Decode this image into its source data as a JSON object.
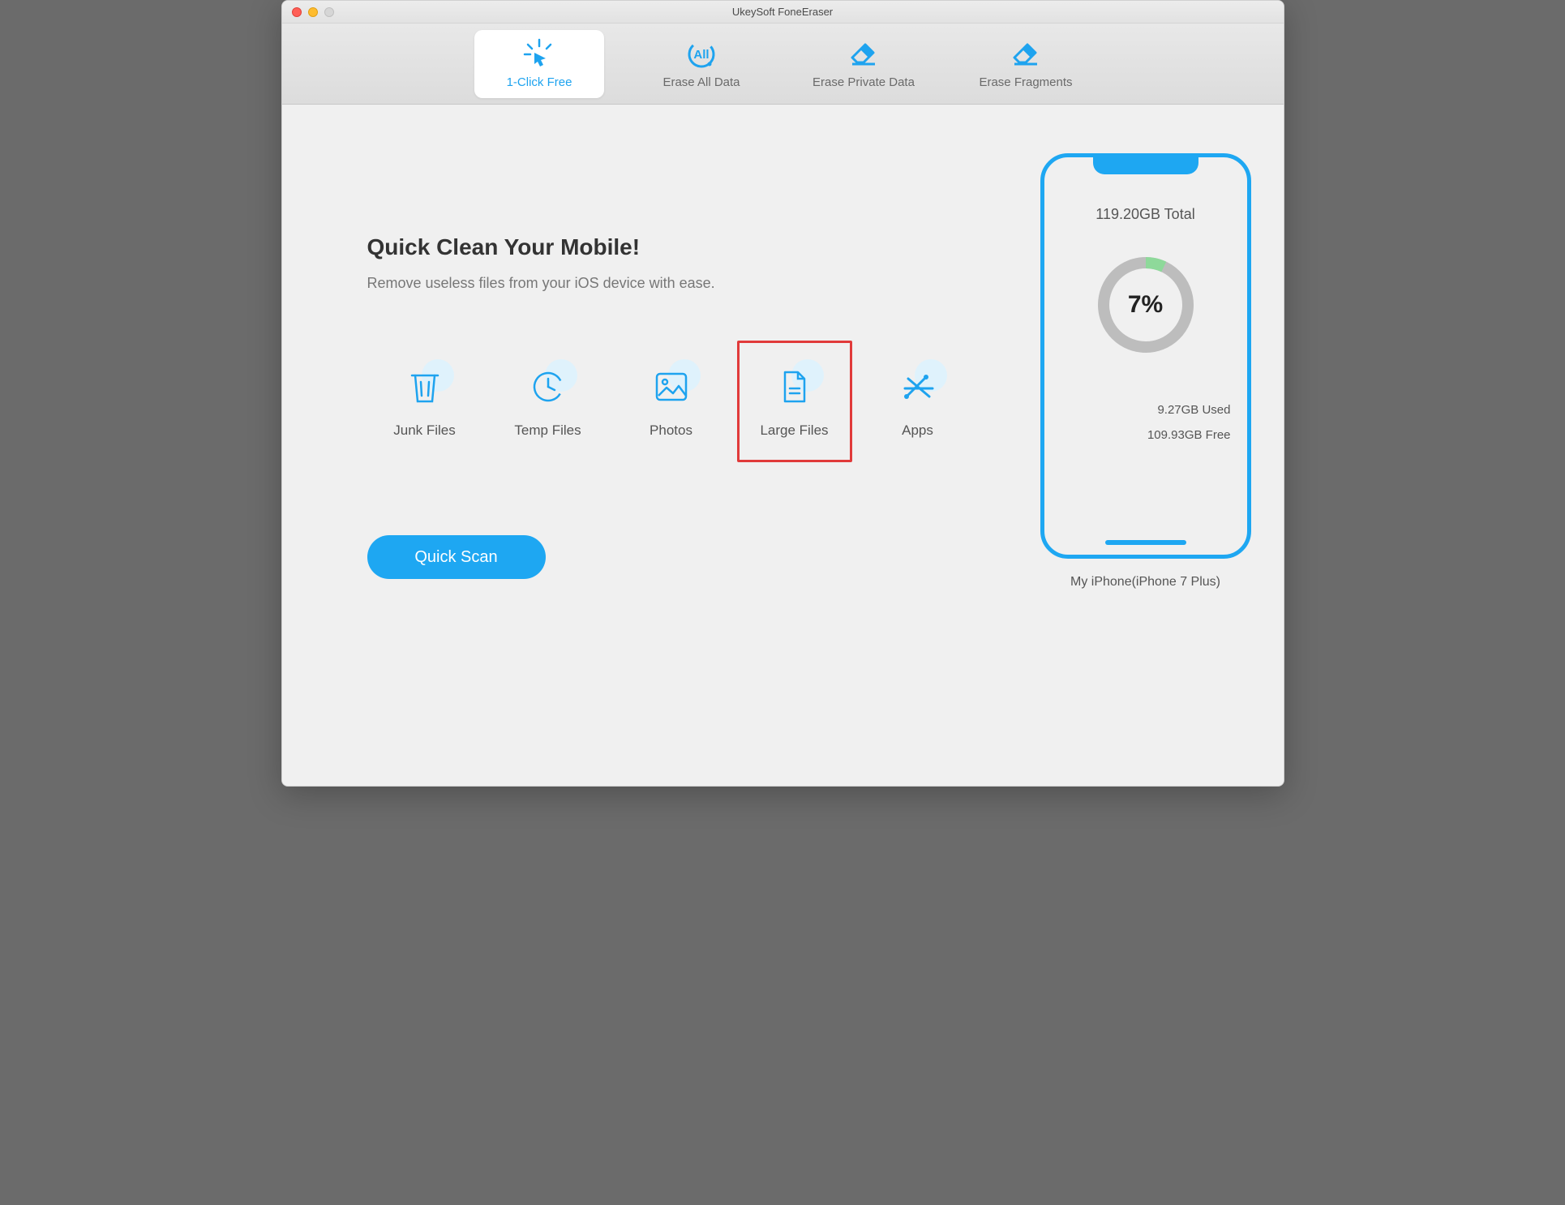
{
  "window": {
    "title": "UkeySoft FoneEraser"
  },
  "tabs": [
    {
      "label": "1-Click Free"
    },
    {
      "label": "Erase All Data"
    },
    {
      "label": "Erase Private Data"
    },
    {
      "label": "Erase Fragments"
    }
  ],
  "main": {
    "heading": "Quick Clean Your Mobile!",
    "subheading": "Remove useless files from your iOS device with ease.",
    "scan_button": "Quick Scan",
    "categories": [
      {
        "label": "Junk Files"
      },
      {
        "label": "Temp Files"
      },
      {
        "label": "Photos"
      },
      {
        "label": "Large Files"
      },
      {
        "label": "Apps"
      }
    ]
  },
  "device": {
    "total": "119.20GB Total",
    "percent": "7%",
    "used": "9.27GB Used",
    "free": "109.93GB Free",
    "name": "My iPhone(iPhone 7 Plus)"
  },
  "colors": {
    "accent": "#1ea7f2"
  }
}
